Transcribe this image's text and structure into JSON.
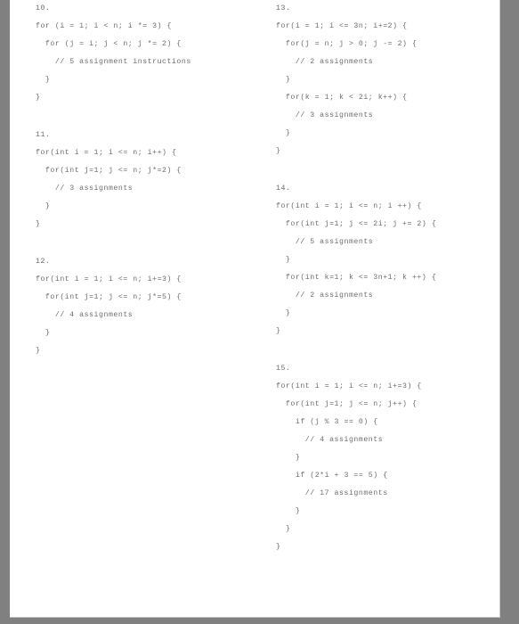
{
  "document": {
    "page_background": "#808080",
    "sheet_background": "#ffffff",
    "text_color": "#6e6e6e"
  },
  "columns": [
    {
      "name": "left-column",
      "exercises": [
        {
          "number": "10.",
          "lines": [
            "for (i = 1; i < n; i *= 3) {",
            "  for (j = i; j < n; j *= 2) {",
            "    // 5 assignment instructions",
            "  }",
            "}"
          ]
        },
        {
          "number": "11.",
          "lines": [
            "for(int i = 1; i <= n; i++) {",
            "  for(int j=1; j <= n; j*=2) {",
            "    // 3 assignments",
            "  }",
            "}"
          ]
        },
        {
          "number": "12.",
          "lines": [
            "for(int i = 1; i <= n; i+=3) {",
            "  for(int j=1; j <= n; j*=5) {",
            "    // 4 assignments",
            "  }",
            "}"
          ]
        }
      ]
    },
    {
      "name": "right-column",
      "exercises": [
        {
          "number": "13.",
          "lines": [
            "for(i = 1; i <= 3n; i+=2) {",
            "  for(j = n; j > 0; j -= 2) {",
            "    // 2 assignments",
            "  }",
            "  for(k = 1; k < 2i; k++) {",
            "    // 3 assignments",
            "  }",
            "}"
          ]
        },
        {
          "number": "14.",
          "lines": [
            "for(int i = 1; i <= n; i ++) {",
            "  for(int j=1; j <= 2i; j += 2) {",
            "    // 5 assignments",
            "  }",
            "  for(int k=1; k <= 3n+1; k ++) {",
            "    // 2 assignments",
            "  }",
            "}"
          ]
        },
        {
          "number": "15.",
          "lines": [
            "for(int i = 1; i <= n; i+=3) {",
            "  for(int j=1; j <= n; j++) {",
            "    if (j % 3 == 0) {",
            "      // 4 assignments",
            "    }",
            "    if (2*i + 3 == 5) {",
            "      // 17 assignments",
            "    }",
            "  }",
            "}"
          ]
        }
      ]
    }
  ]
}
